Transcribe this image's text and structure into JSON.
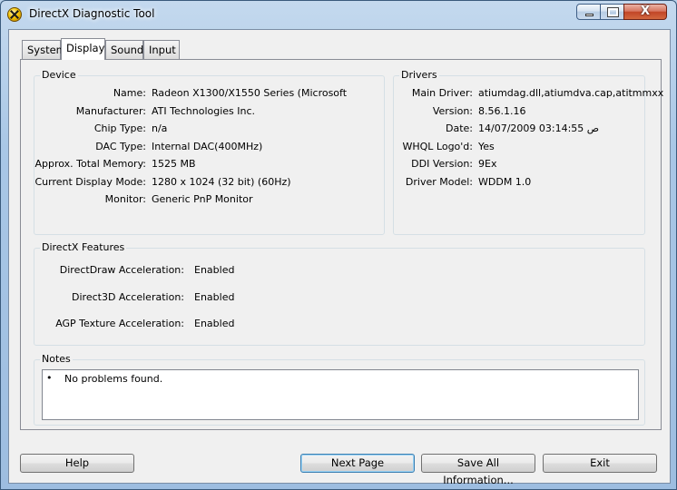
{
  "window": {
    "title": "DirectX Diagnostic Tool",
    "icon": "directx-icon",
    "controls": {
      "minimize": "minimize-icon",
      "maximize": "maximize-icon",
      "close_glyph": "X"
    }
  },
  "tabs": [
    {
      "label": "System",
      "active": false
    },
    {
      "label": "Display",
      "active": true
    },
    {
      "label": "Sound",
      "active": false
    },
    {
      "label": "Input",
      "active": false
    }
  ],
  "device": {
    "title": "Device",
    "rows": [
      {
        "label": "Name:",
        "value": "Radeon X1300/X1550 Series (Microsoft"
      },
      {
        "label": "Manufacturer:",
        "value": "ATI Technologies Inc."
      },
      {
        "label": "Chip Type:",
        "value": "n/a"
      },
      {
        "label": "DAC Type:",
        "value": "Internal DAC(400MHz)"
      },
      {
        "label": "Approx. Total Memory:",
        "value": "1525 MB"
      },
      {
        "label": "Current Display Mode:",
        "value": "1280 x 1024 (32 bit) (60Hz)"
      },
      {
        "label": "Monitor:",
        "value": "Generic PnP Monitor"
      }
    ]
  },
  "drivers": {
    "title": "Drivers",
    "rows": [
      {
        "label": "Main Driver:",
        "value": "atiumdag.dll,atiumdva.cap,atitmmxx"
      },
      {
        "label": "Version:",
        "value": "8.56.1.16"
      },
      {
        "label": "Date:",
        "value": "14/07/2009 03:14:55 ص"
      },
      {
        "label": "WHQL Logo'd:",
        "value": "Yes"
      },
      {
        "label": "DDI Version:",
        "value": "9Ex"
      },
      {
        "label": "Driver Model:",
        "value": "WDDM 1.0"
      }
    ]
  },
  "features": {
    "title": "DirectX Features",
    "rows": [
      {
        "label": "DirectDraw Acceleration:",
        "value": "Enabled"
      },
      {
        "label": "Direct3D Acceleration:",
        "value": "Enabled"
      },
      {
        "label": "AGP Texture Acceleration:",
        "value": "Enabled"
      }
    ]
  },
  "notes": {
    "title": "Notes",
    "bullet": "•",
    "items": [
      "No problems found."
    ]
  },
  "buttons": {
    "help": "Help",
    "next_page": "Next Page",
    "save_all": "Save All Information...",
    "exit": "Exit"
  }
}
